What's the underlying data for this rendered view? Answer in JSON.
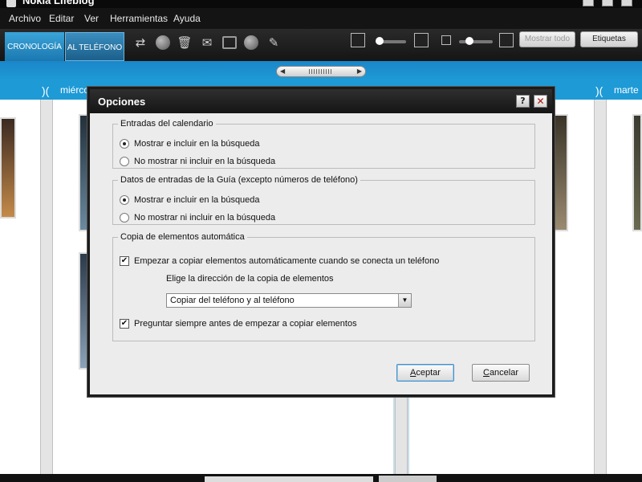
{
  "window": {
    "title": "Nokia Lifeblog"
  },
  "menu": [
    "Archivo",
    "Editar",
    "Ver",
    "Herramientas",
    "Ayuda"
  ],
  "toolbar": {
    "tabs": [
      "CRONOLOGÍA",
      "AL TELÉFONO"
    ],
    "mostrar_todo": "Mostrar todo",
    "etiquetas": "Etiquetas"
  },
  "timeline": {
    "day_left": "miércoles",
    "day_right": "marte"
  },
  "dialog": {
    "title": "Opciones",
    "help": "?",
    "close": "✕",
    "group1": {
      "legend": "Entradas del calendario",
      "opt_show": "Mostrar e incluir en la búsqueda",
      "opt_hide": "No mostrar ni incluir en la búsqueda",
      "selected": "show"
    },
    "group2": {
      "legend": "Datos de entradas de la Guía (excepto números de teléfono)",
      "opt_show": "Mostrar e incluir en la búsqueda",
      "opt_hide": "No mostrar ni incluir en la búsqueda",
      "selected": "show"
    },
    "group3": {
      "legend": "Copia de elementos automática",
      "auto_copy": "Empezar a copiar elementos automáticamente cuando se conecta un teléfono",
      "auto_copy_checked": true,
      "direction_label": "Elige la dirección de la copia de elementos",
      "direction_value": "Copiar del teléfono y al teléfono",
      "ask_before": "Preguntar siempre antes de empezar a copiar elementos",
      "ask_before_checked": true
    },
    "ok_label_underlined": "A",
    "ok_label_rest": "ceptar",
    "cancel_label_underlined": "C",
    "cancel_label_rest": "ancelar"
  }
}
